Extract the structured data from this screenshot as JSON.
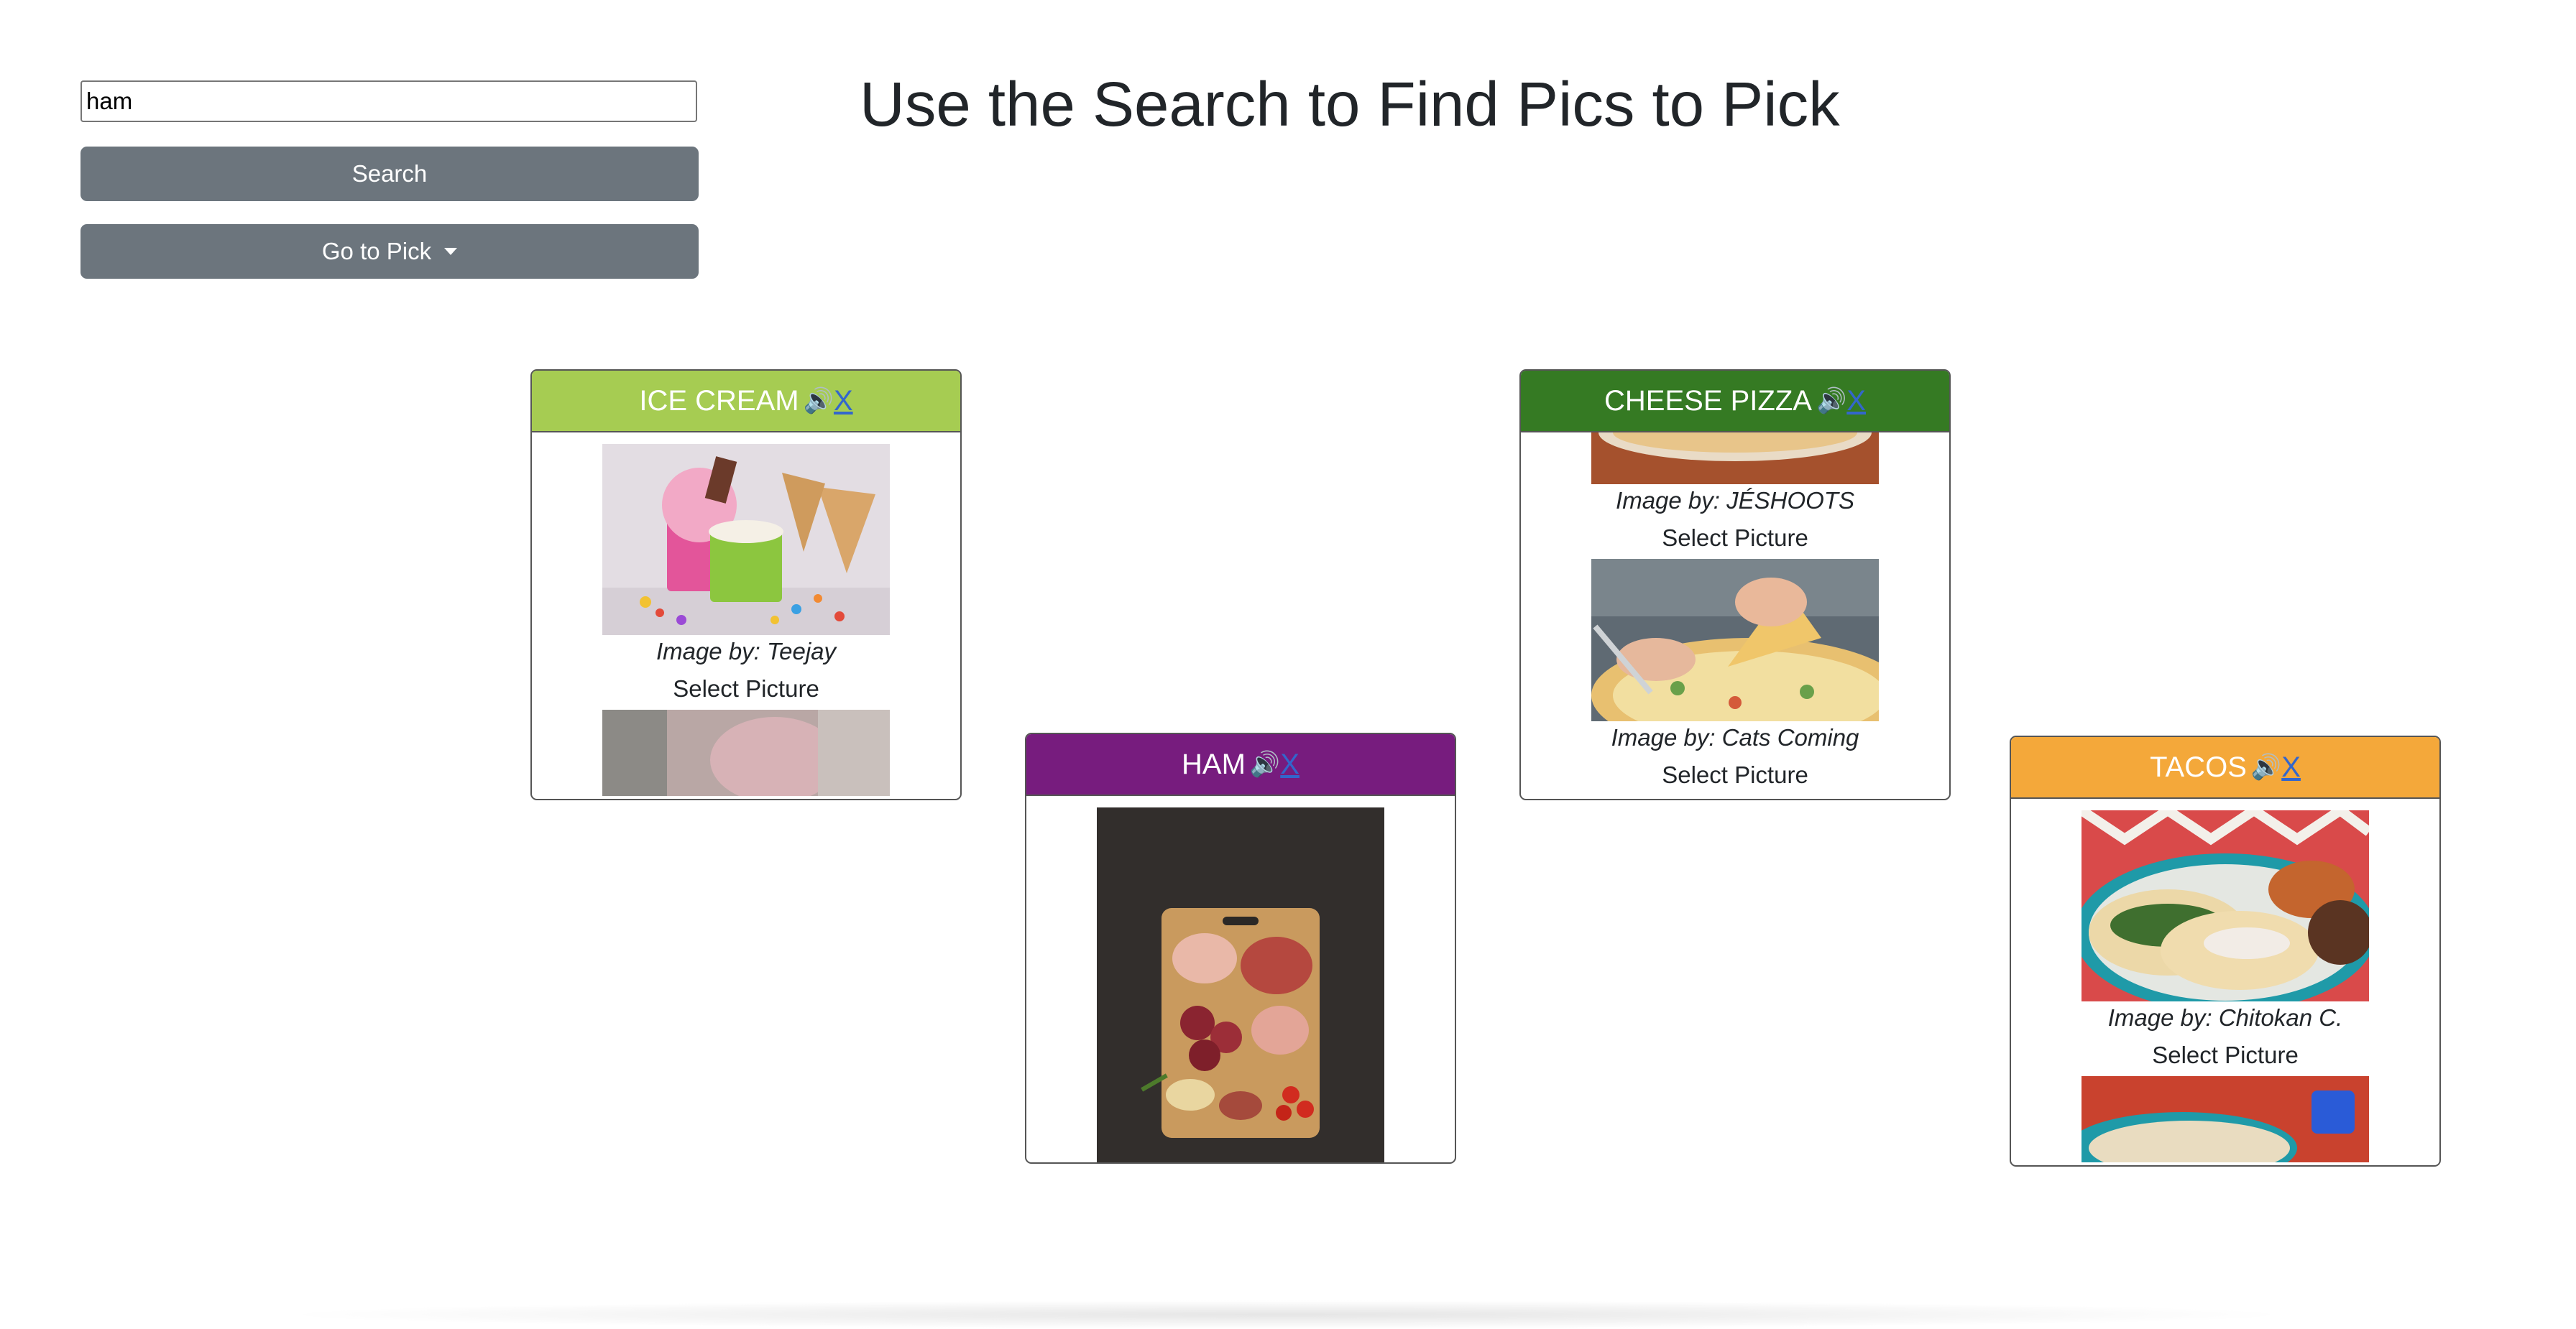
{
  "search": {
    "value": "ham"
  },
  "buttons": {
    "search_label": "Search",
    "pick_label": "Go to Pick"
  },
  "title": "Use the Search to Find Pics to Pick",
  "colors": {
    "ice_cream": "#a6cc52",
    "ham": "#771c7e",
    "cheese_pizza": "#357a23",
    "tacos": "#f4a83a",
    "button": "#6c757d"
  },
  "cards": [
    {
      "title": "ICE CREAM",
      "speaker_icon": "🔊",
      "close": "X",
      "credit": "Image by: Teejay",
      "select": "Select Picture"
    },
    {
      "title": "HAM",
      "speaker_icon": "🔊",
      "close": "X"
    },
    {
      "title": "CHEESE PIZZA",
      "speaker_icon": "🔊",
      "close": "X",
      "credit_1": "Image by: JÉSHOOTS",
      "select_1": "Select Picture",
      "credit_2": "Image by: Cats Coming",
      "select_2": "Select Picture"
    },
    {
      "title": "TACOS",
      "speaker_icon": "🔊",
      "close": "X",
      "credit": "Image by: Chitokan C.",
      "select": "Select Picture"
    }
  ]
}
